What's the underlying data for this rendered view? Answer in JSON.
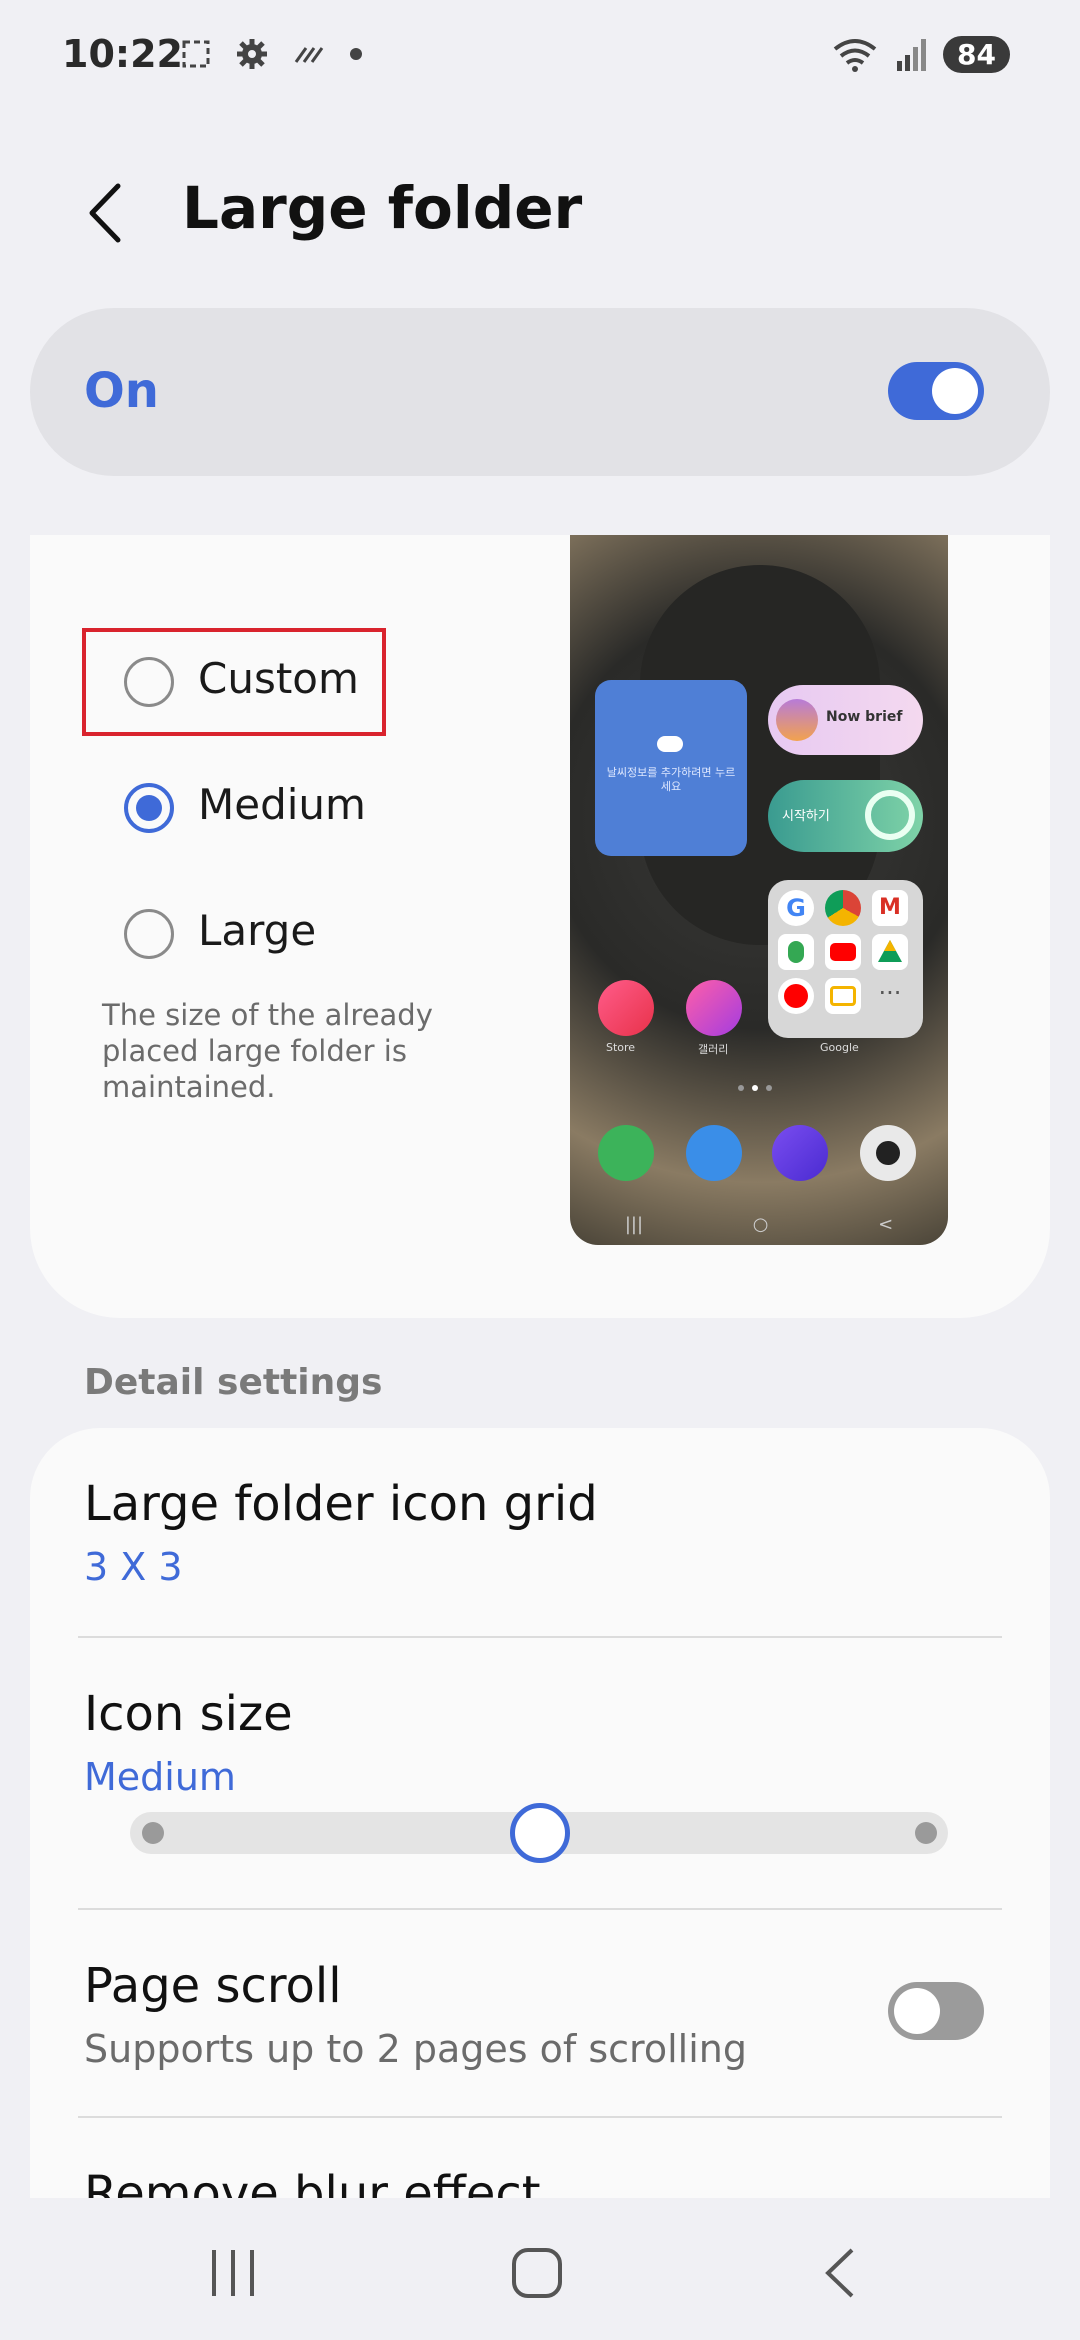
{
  "status_bar": {
    "time": "10:22",
    "battery": "84"
  },
  "header": {
    "title": "Large folder"
  },
  "master": {
    "label": "On",
    "state": "on"
  },
  "size_options": {
    "items": [
      {
        "label": "Custom",
        "selected": false
      },
      {
        "label": "Medium",
        "selected": true
      },
      {
        "label": "Large",
        "selected": false
      }
    ],
    "note": "The size of the already placed large folder is maintained."
  },
  "preview": {
    "widget_now_brief": "Now brief",
    "widget_start": "시작하기",
    "weather_hint": "날씨정보를 추가하려면 누르세요",
    "app_store": "Store",
    "app_gallery": "갤러리",
    "folder_google": "Google"
  },
  "detail": {
    "section_title": "Detail settings",
    "grid": {
      "title": "Large folder icon grid",
      "value": "3 X 3"
    },
    "icon_size": {
      "title": "Icon size",
      "value": "Medium",
      "level": 0.5
    },
    "page_scroll": {
      "title": "Page scroll",
      "subtitle": "Supports up to 2 pages of scrolling",
      "state": "off"
    },
    "blur": {
      "title": "Remove blur effect"
    }
  },
  "colors": {
    "accent": "#3f6ad8",
    "highlight": "#d9232d",
    "background": "#f0f0f4"
  }
}
